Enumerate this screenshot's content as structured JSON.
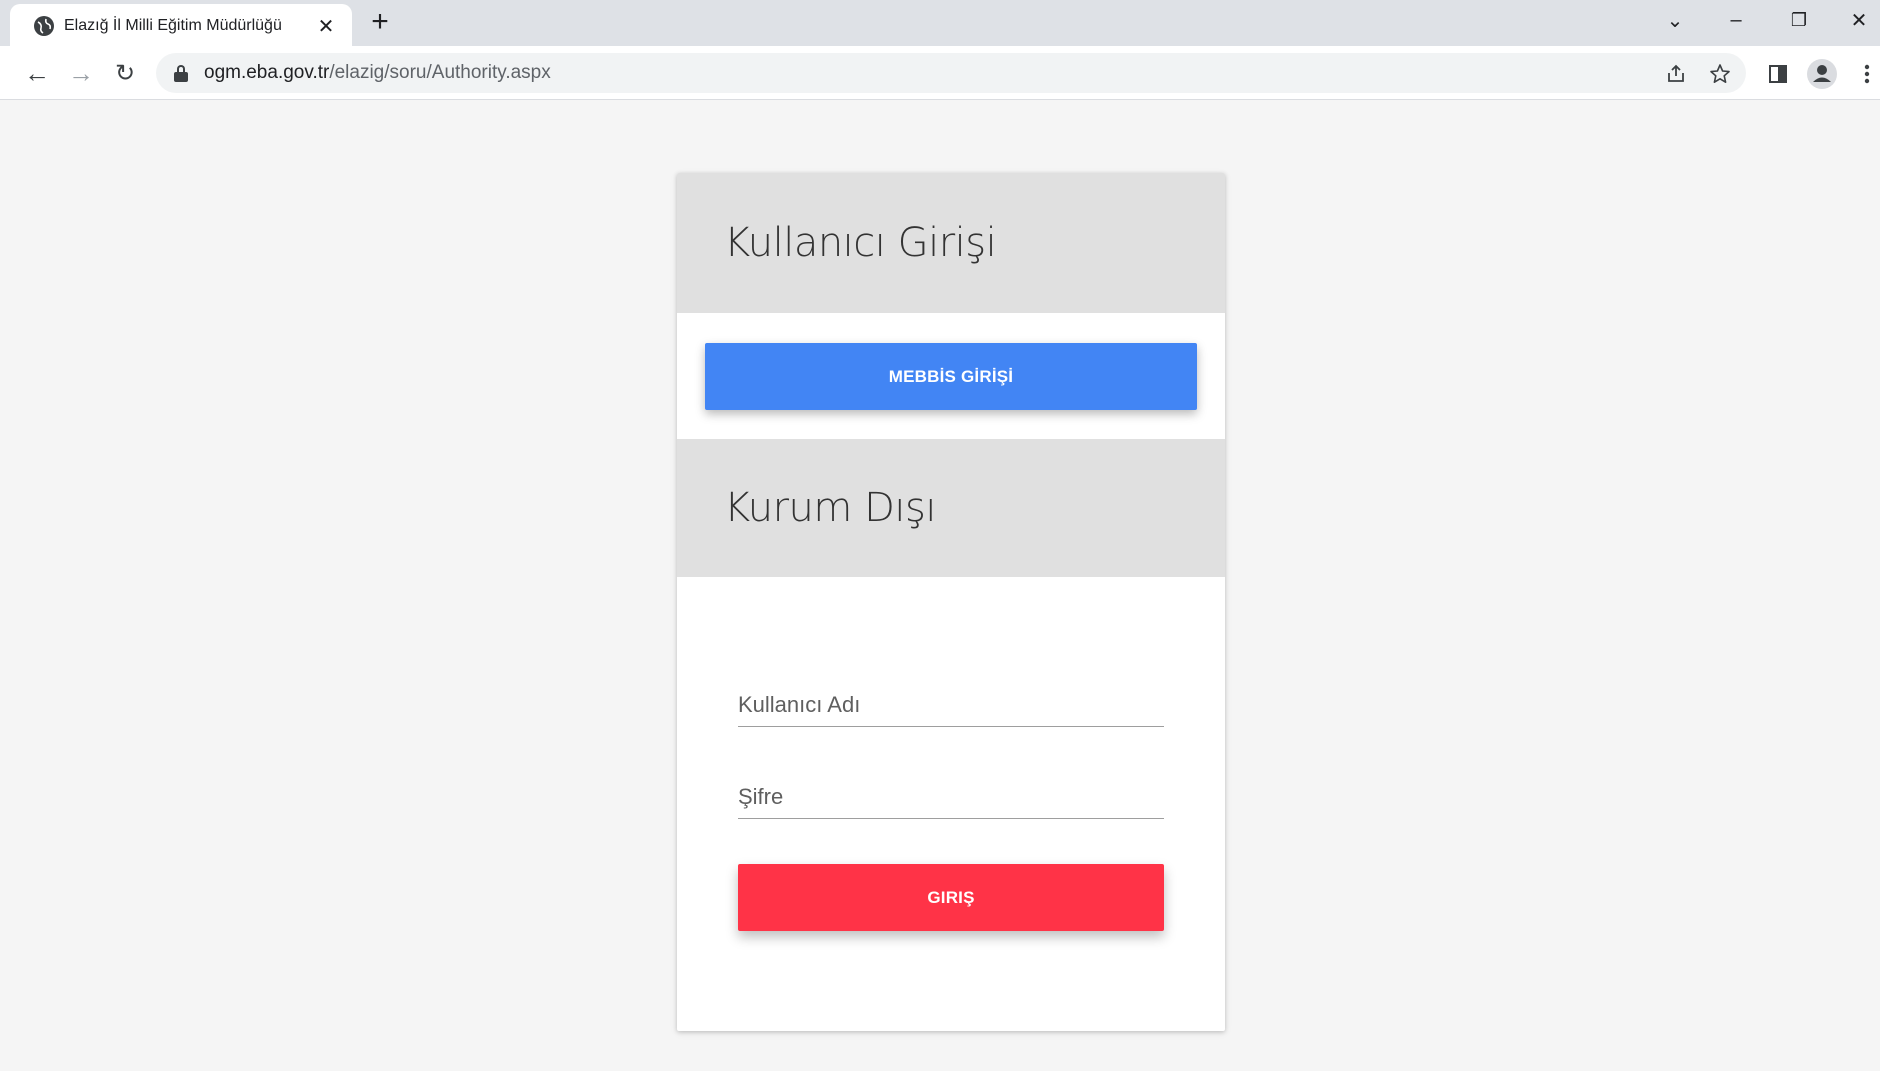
{
  "browser": {
    "tab_title": "Elazığ İl Milli Eğitim Müdürlüğü",
    "tab_close": "✕",
    "new_tab": "+",
    "url_domain": "ogm.eba.gov.tr",
    "url_path": "/elazig/soru/Authority.aspx",
    "window_controls": {
      "dropdown": "⌄",
      "minimize": "–",
      "restore": "❐",
      "close": "✕"
    },
    "nav": {
      "back": "←",
      "forward": "→",
      "reload": "↻"
    },
    "icons": [
      "share-icon",
      "bookmark-star-icon",
      "side-panel-icon",
      "profile-icon",
      "menu-icon"
    ]
  },
  "login": {
    "section1_title": "Kullanıcı Girişi",
    "mebbis_button": "MEBBİS GİRİŞİ",
    "section2_title": "Kurum Dışı",
    "username_placeholder": "Kullanıcı Adı",
    "password_placeholder": "Şifre",
    "submit_button": "GIRIŞ"
  },
  "colors": {
    "mebbis_blue": "#4285f4",
    "submit_red": "#ff3347",
    "header_gray": "#e0e0e0",
    "page_bg": "#f5f5f5"
  }
}
